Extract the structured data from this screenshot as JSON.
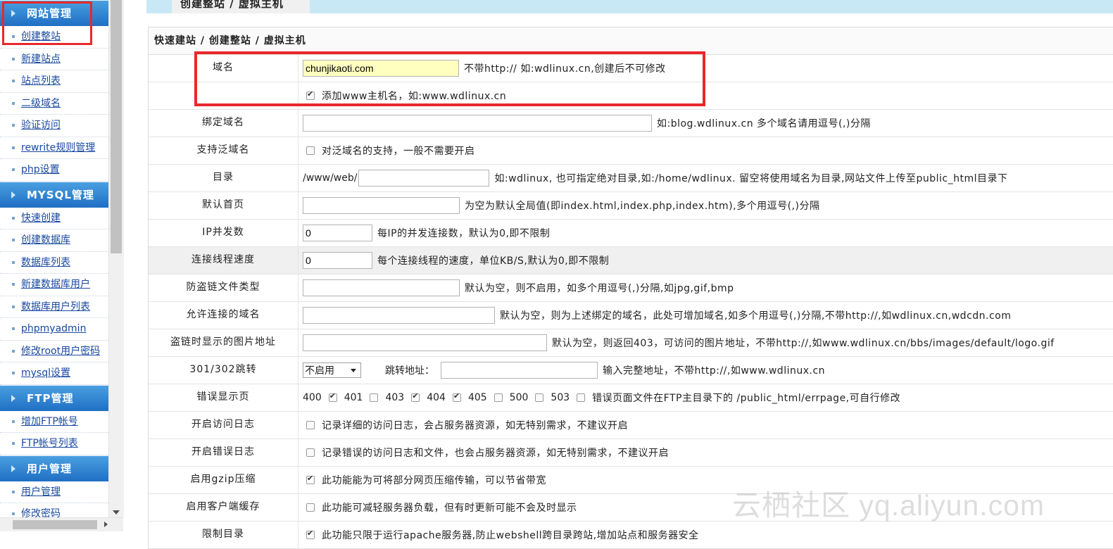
{
  "sidebar": {
    "sections": [
      {
        "title": "网站管理",
        "items": [
          "创建整站",
          "新建站点",
          "站点列表",
          "二级域名",
          "验证访问",
          "rewrite规则管理",
          "php设置"
        ]
      },
      {
        "title": "MYSQL管理",
        "items": [
          "快速创建",
          "创建数据库",
          "数据库列表",
          "新建数据库用户",
          "数据库用户列表",
          "phpmyadmin",
          "修改root用户密码",
          "mysql设置"
        ]
      },
      {
        "title": "FTP管理",
        "items": [
          "增加FTP帐号",
          "FTP帐号列表"
        ]
      },
      {
        "title": "用户管理",
        "items": [
          "用户管理",
          "修改密码"
        ]
      }
    ]
  },
  "tab": {
    "label": "创建整站 / 虚拟主机"
  },
  "form": {
    "title": "快速建站 / 创建整站 / 虚拟主机",
    "domain": {
      "label": "域名",
      "value": "chunjikaoti.com",
      "hint": "不带http:// 如:wdlinux.cn,创建后不可修改"
    },
    "add_www": {
      "hint": "添加www主机名，如:www.wdlinux.cn"
    },
    "bind": {
      "label": "绑定域名",
      "value": "",
      "hint": "如:blog.wdlinux.cn 多个域名请用逗号(,)分隔"
    },
    "wildcard": {
      "label": "支持泛域名",
      "hint": "对泛域名的支持，一般不需要开启"
    },
    "dir": {
      "label": "目录",
      "prefix": "/www/web/",
      "value": "",
      "hint": "如:wdlinux, 也可指定绝对目录,如:/home/wdlinux. 留空将使用域名为目录,网站文件上传至public_html目录下"
    },
    "index": {
      "label": "默认首页",
      "value": "",
      "hint": "为空为默认全局值(即index.html,index.php,index.htm),多个用逗号(,)分隔"
    },
    "ip_conn": {
      "label": "IP并发数",
      "value": "0",
      "hint": "每IP的并发连接数，默认为0,即不限制"
    },
    "speed": {
      "label": "连接线程速度",
      "value": "0",
      "hint": "每个连接线程的速度，单位KB/S,默认为0,即不限制"
    },
    "hotlink_types": {
      "label": "防盗链文件类型",
      "value": "",
      "hint": "默认为空，则不启用，如多个用逗号(,)分隔,如jpg,gif,bmp"
    },
    "allowed_domains": {
      "label": "允许连接的域名",
      "value": "",
      "hint": "默认为空，则为上述绑定的域名，此处可增加域名,如多个用逗号(,)分隔,不带http://,如wdlinux.cn,wdcdn.com"
    },
    "hotlink_image": {
      "label": "盗链时显示的图片地址",
      "value": "",
      "hint": "默认为空，则返回403，可访问的图片地址，不带http://,如www.wdlinux.cn/bbs/images/default/logo.gif"
    },
    "redirect": {
      "label": "301/302跳转",
      "select_value": "不启用",
      "addr_label": "跳转地址：",
      "value": "",
      "hint": "输入完整地址，不带http://,如www.wdlinux.cn"
    },
    "errpages": {
      "label": "错误显示页",
      "codes": [
        "400",
        "401",
        "403",
        "404",
        "405",
        "500",
        "503"
      ],
      "hint": "错误页面文件在FTP主目录下的 /public_html/errpage,可自行修改"
    },
    "access_log": {
      "label": "开启访问日志",
      "hint": "记录详细的访问日志，会占服务器资源，如无特别需求，不建议开启"
    },
    "error_log": {
      "label": "开启错误日志",
      "hint": "记录错误的访问日志和文件，也会占服务器资源，如无特别需求，不建议开启"
    },
    "gzip": {
      "label": "启用gzip压缩",
      "hint": "此功能能为可将部分网页压缩传输，可以节省带宽"
    },
    "client_cache": {
      "label": "启用客户端缓存",
      "hint": "此功能可减轻服务器负载，但有时更新可能不会及时显示"
    },
    "restrict_dir": {
      "label": "限制目录",
      "hint": "此功能只限于运行apache服务器,防止webshell跨目录跨站,增加站点和服务器安全"
    }
  },
  "watermark": "云栖社区 yq.aliyun.com",
  "colors": {
    "highlight": "#e8282b",
    "sidebar_header": "#1f6fc4",
    "tabbar": "#c8e8f6"
  }
}
